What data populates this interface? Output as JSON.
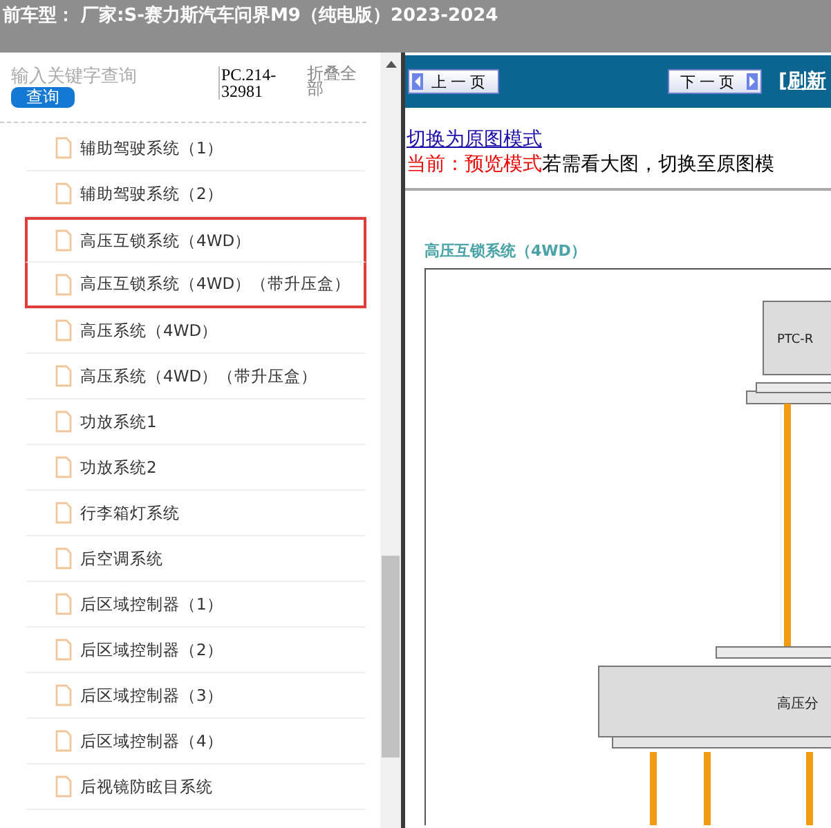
{
  "title_bar": {
    "text": "前车型： 厂家:S-赛力斯汽车问界M9（纯电版）2023-2024"
  },
  "sidebar": {
    "search": {
      "placeholder": "输入关键字查询"
    },
    "search_button": "查询",
    "code": "PC.214-32981",
    "collapse_all": "折叠全部",
    "items": [
      {
        "label": "辅助驾驶系统（1）",
        "highlighted": false
      },
      {
        "label": "辅助驾驶系统（2）",
        "highlighted": false
      },
      {
        "label": "高压互锁系统（4WD）",
        "highlighted": true
      },
      {
        "label": "高压互锁系统（4WD）（带升压盒）",
        "highlighted": true
      },
      {
        "label": "高压系统（4WD）",
        "highlighted": false
      },
      {
        "label": "高压系统（4WD）（带升压盒）",
        "highlighted": false
      },
      {
        "label": "功放系统1",
        "highlighted": false
      },
      {
        "label": "功放系统2",
        "highlighted": false
      },
      {
        "label": "行李箱灯系统",
        "highlighted": false
      },
      {
        "label": "后空调系统",
        "highlighted": false
      },
      {
        "label": "后区域控制器（1）",
        "highlighted": false
      },
      {
        "label": "后区域控制器（2）",
        "highlighted": false
      },
      {
        "label": "后区域控制器（3）",
        "highlighted": false
      },
      {
        "label": "后区域控制器（4）",
        "highlighted": false
      },
      {
        "label": "后视镜防眩目系统",
        "highlighted": false
      }
    ]
  },
  "nav": {
    "prev": "上一页",
    "next": "下一页",
    "refresh": "[刷新"
  },
  "content": {
    "switch_link": "切换为原图模式",
    "mode_label": "当前：预览模式",
    "mode_hint": "若需看大图，切换至原图模",
    "diagram_title": "高压互锁系统（4WD）",
    "diagram_labels": [
      "PTC-R",
      "高压分"
    ]
  }
}
